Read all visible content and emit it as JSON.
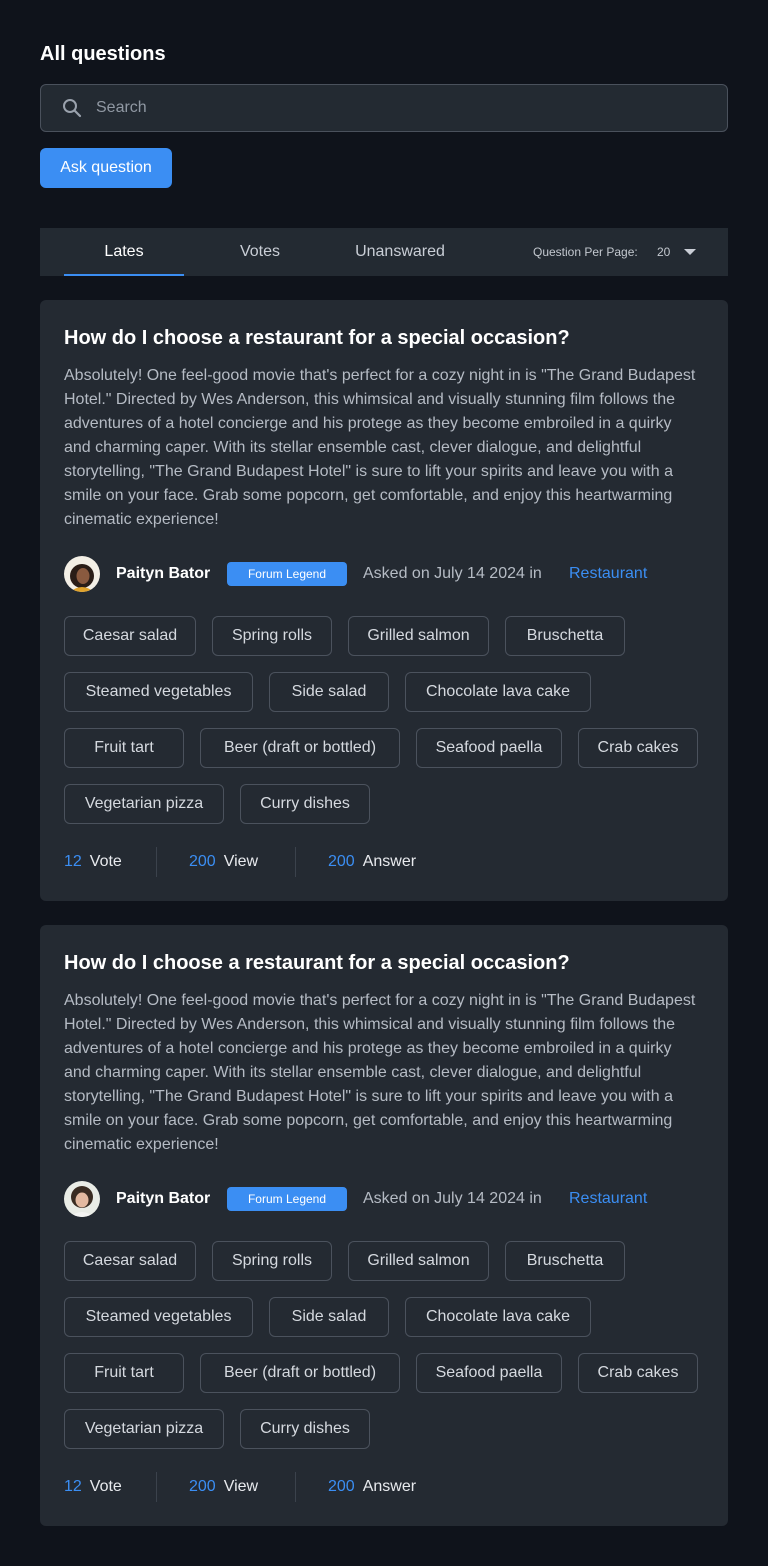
{
  "page": {
    "title": "All questions"
  },
  "search": {
    "placeholder": "Search"
  },
  "ask_button": {
    "label": "Ask question"
  },
  "tabs": [
    {
      "label": "Lates",
      "active": true
    },
    {
      "label": "Votes",
      "active": false
    },
    {
      "label": "Unanswared",
      "active": false
    }
  ],
  "per_page": {
    "label": "Question Per Page:",
    "value": "20"
  },
  "colors": {
    "accent": "#3b8ef3",
    "background": "#0f131b",
    "card": "#242a32"
  },
  "questions": [
    {
      "title": "How do I choose a restaurant for a special occasion?",
      "body": "Absolutely! One feel-good movie that's perfect for a cozy night in is \"The Grand Budapest Hotel.\" Directed by Wes Anderson, this whimsical and visually stunning film follows the adventures of a hotel concierge and his protege as they become embroiled in a quirky and charming caper. With its stellar ensemble cast, clever dialogue, and delightful storytelling, \"The Grand Budapest Hotel\" is sure to lift your spirits and leave you with a smile on your face. Grab some popcorn, get comfortable, and enjoy this heartwarming cinematic experience!",
      "author": "Paityn Bator",
      "badge": "Forum Legend",
      "asked": "Asked on July 14 2024 in",
      "category": "Restaurant",
      "tags": [
        "Caesar salad",
        "Spring rolls",
        "Grilled salmon",
        "Bruschetta",
        "Steamed vegetables",
        "Side salad",
        "Chocolate lava cake",
        "Fruit tart",
        "Beer (draft or bottled)",
        "Seafood paella",
        "Crab cakes",
        "Vegetarian pizza",
        "Curry dishes"
      ],
      "stats": {
        "votes": "12",
        "vote_label": "Vote",
        "views": "200",
        "view_label": "View",
        "answers": "200",
        "answer_label": "Answer"
      }
    },
    {
      "title": "How do I choose a restaurant for a special occasion?",
      "body": "Absolutely! One feel-good movie that's perfect for a cozy night in is \"The Grand Budapest Hotel.\" Directed by Wes Anderson, this whimsical and visually stunning film follows the adventures of a hotel concierge and his protege as they become embroiled in a quirky and charming caper. With its stellar ensemble cast, clever dialogue, and delightful storytelling, \"The Grand Budapest Hotel\" is sure to lift your spirits and leave you with a smile on your face. Grab some popcorn, get comfortable, and enjoy this heartwarming cinematic experience!",
      "author": "Paityn Bator",
      "badge": "Forum Legend",
      "asked": "Asked on July 14 2024 in",
      "category": "Restaurant",
      "tags": [
        "Caesar salad",
        "Spring rolls",
        "Grilled salmon",
        "Bruschetta",
        "Steamed vegetables",
        "Side salad",
        "Chocolate lava cake",
        "Fruit tart",
        "Beer (draft or bottled)",
        "Seafood paella",
        "Crab cakes",
        "Vegetarian pizza",
        "Curry dishes"
      ],
      "stats": {
        "votes": "12",
        "vote_label": "Vote",
        "views": "200",
        "view_label": "View",
        "answers": "200",
        "answer_label": "Answer"
      }
    }
  ]
}
